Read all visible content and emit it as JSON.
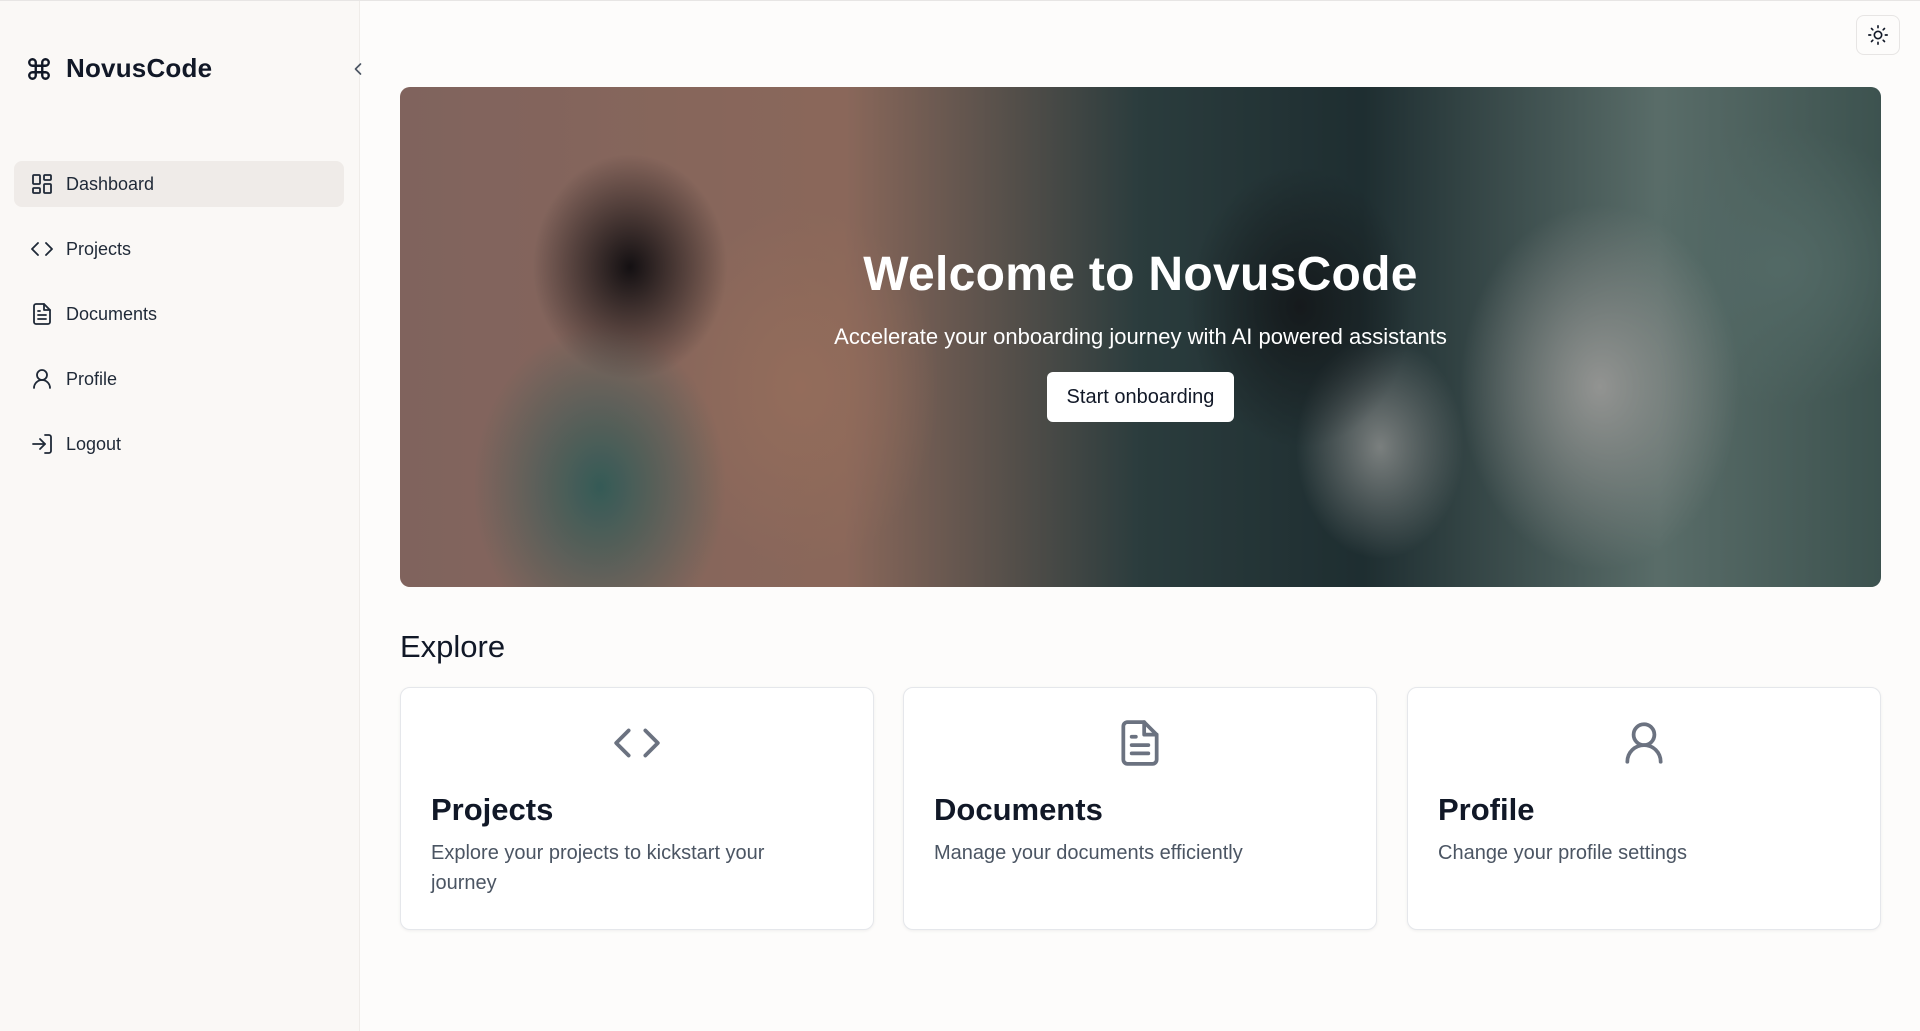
{
  "sidebar": {
    "brand": {
      "name": "NovusCode",
      "icon": "command-icon"
    },
    "collapse_icon": "chevron-left-icon",
    "items": [
      {
        "label": "Dashboard",
        "icon": "dashboard-icon",
        "active": true
      },
      {
        "label": "Projects",
        "icon": "code-icon",
        "active": false
      },
      {
        "label": "Documents",
        "icon": "document-icon",
        "active": false
      },
      {
        "label": "Profile",
        "icon": "user-icon",
        "active": false
      },
      {
        "label": "Logout",
        "icon": "logout-icon",
        "active": false
      }
    ]
  },
  "header": {
    "theme_toggle_icon": "sun-icon"
  },
  "hero": {
    "title": "Welcome to NovusCode",
    "subtitle": "Accelerate your onboarding journey with AI powered assistants",
    "button_label": "Start onboarding"
  },
  "explore": {
    "title": "Explore",
    "cards": [
      {
        "title": "Projects",
        "description": "Explore your projects to kickstart your journey",
        "icon": "code-icon"
      },
      {
        "title": "Documents",
        "description": "Manage your documents efficiently",
        "icon": "document-icon"
      },
      {
        "title": "Profile",
        "description": "Change your profile settings",
        "icon": "user-icon"
      }
    ]
  },
  "colors": {
    "background": "#fdfcfb",
    "sidebar_bg": "#faf8f6",
    "active_item_bg": "#efebe8",
    "text": "#111827",
    "muted_text": "#4b5563"
  }
}
